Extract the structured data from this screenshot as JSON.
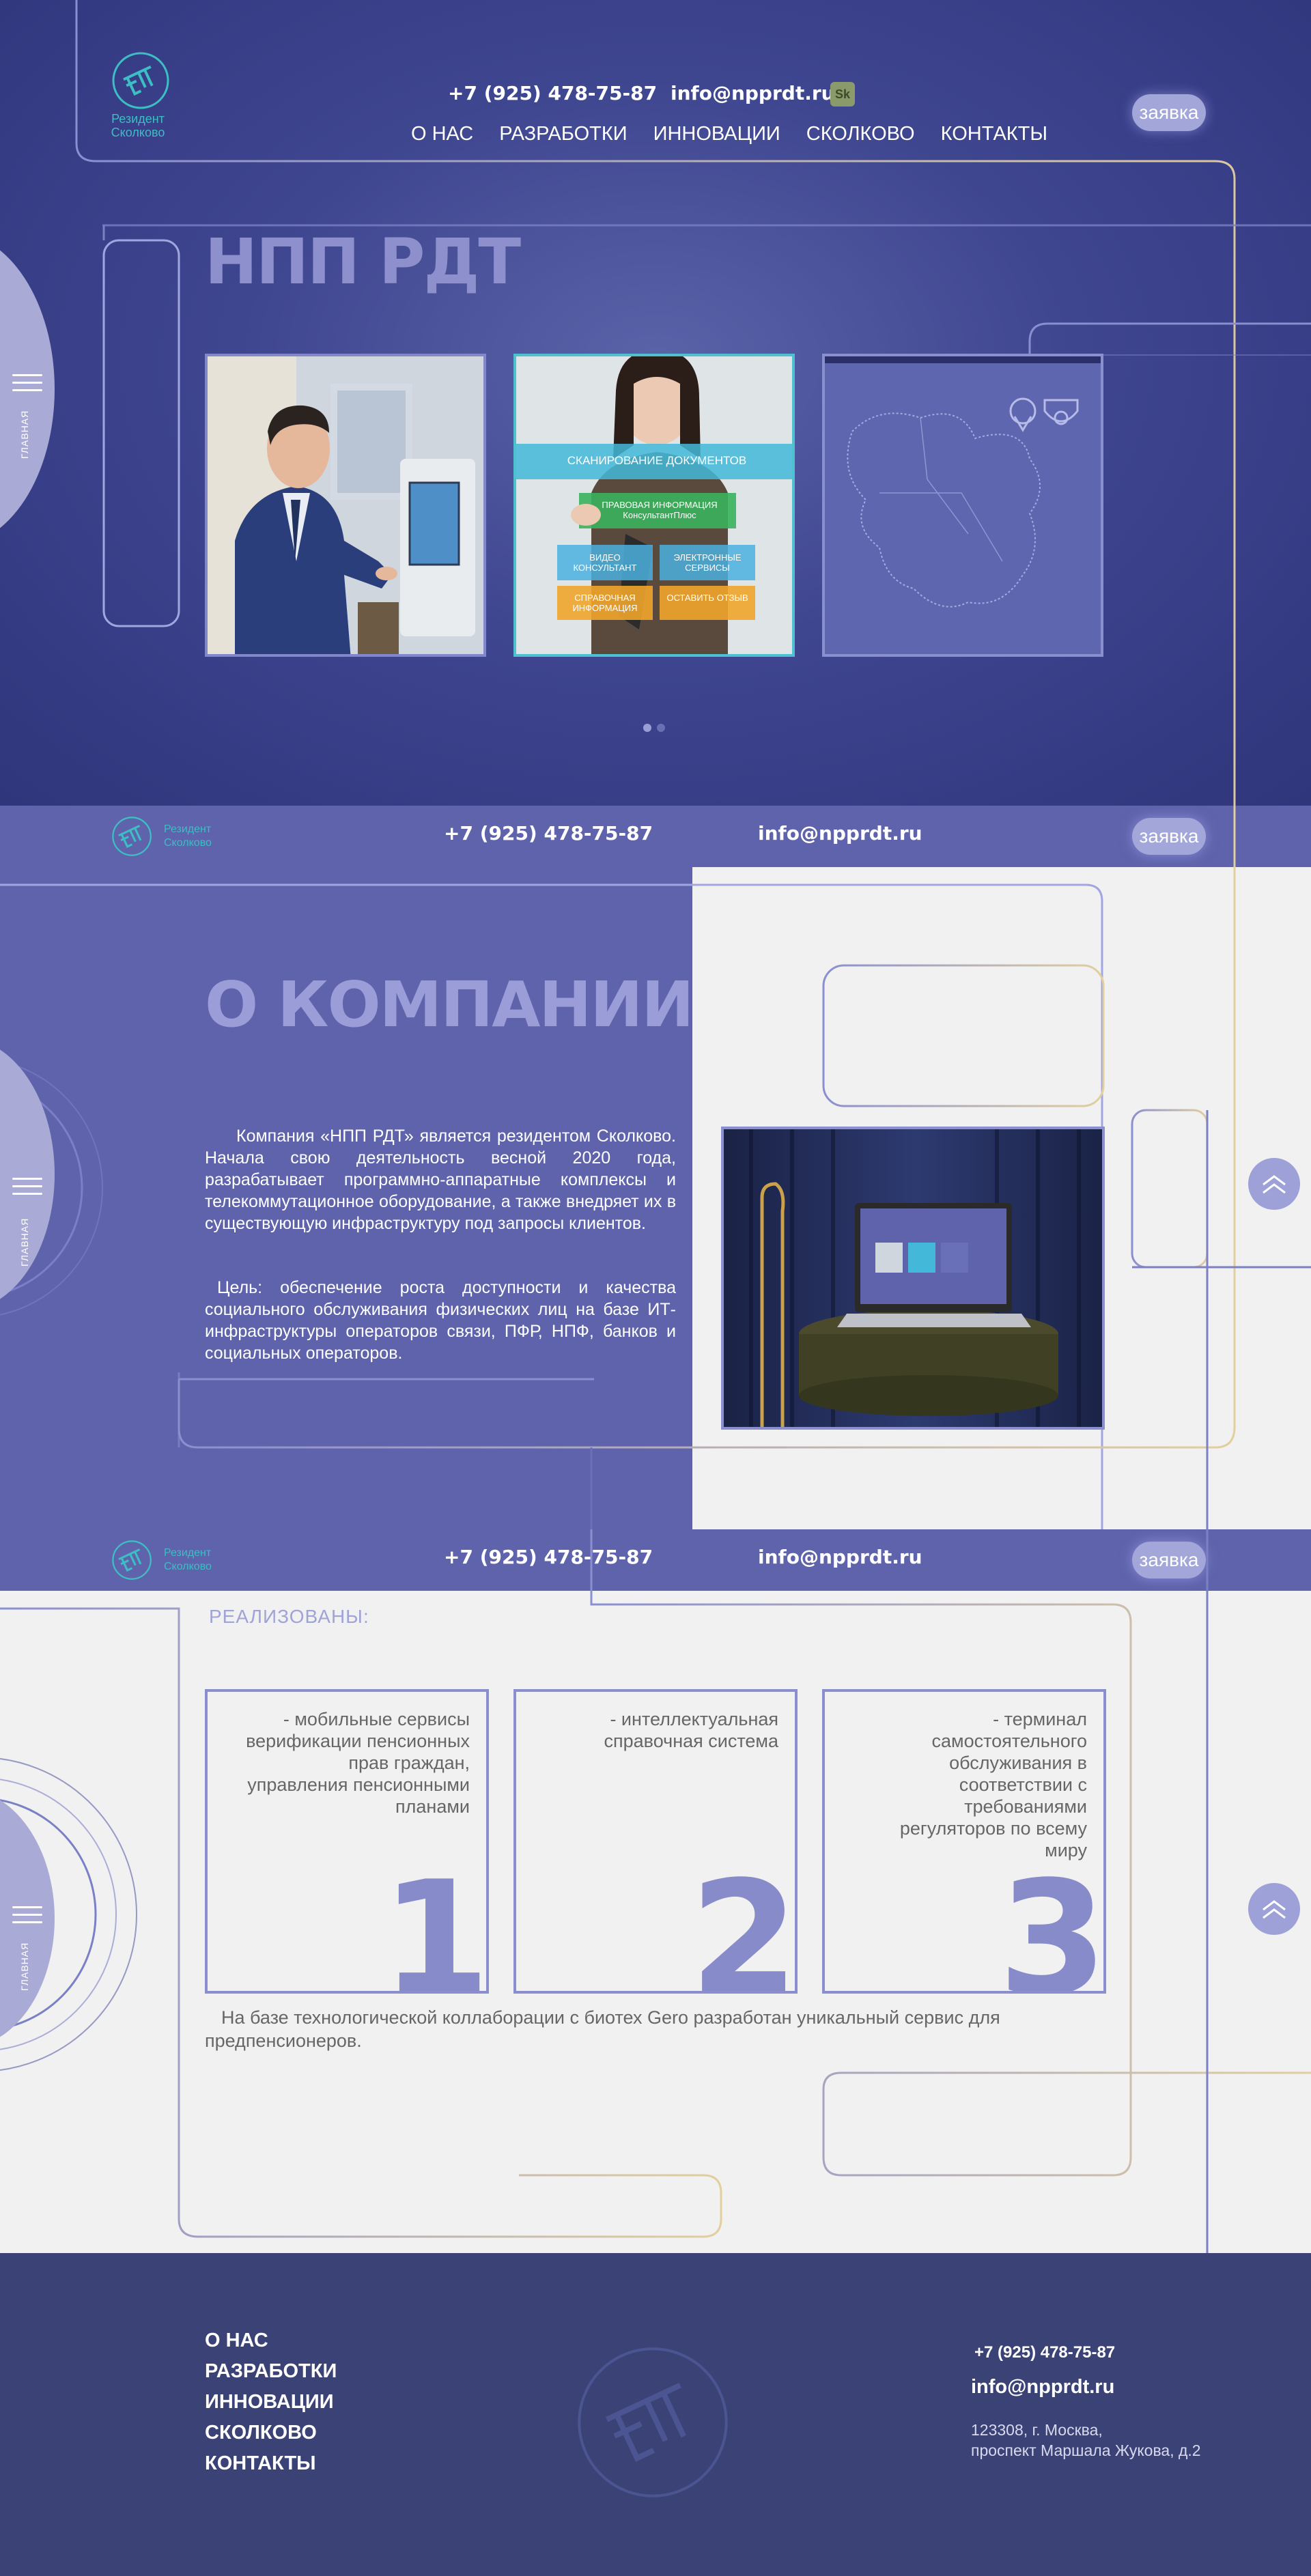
{
  "header": {
    "logo_text_line1": "Резидент",
    "logo_text_line2": "Сколково",
    "phone": "+7 (925) 478-75-87",
    "email": "info@npprdt.ru",
    "sk_badge": "Sk",
    "nav": [
      "О НАС",
      "РАЗРАБОТКИ",
      "ИННОВАЦИИ",
      "СКОЛКОВО",
      "КОНТАКТЫ"
    ],
    "request_button": "заявка"
  },
  "side_menu": {
    "label": "ГЛАВНАЯ",
    "icon": "hamburger-icon"
  },
  "hero": {
    "title": "НПП РДТ",
    "cards": [
      {
        "name": "terminal-photo"
      },
      {
        "name": "kiosk-menu-photo",
        "menu": [
          "СКАНИРОВАНИЕ ДОКУМЕНТОВ",
          "ПРАВОВАЯ ИНФОРМАЦИЯ КонсультантПлюс",
          "ВИДЕО КОНСУЛЬТАНТ",
          "ЭЛЕКТРОННЫЕ СЕРВИСЫ",
          "СПРАВОЧНАЯ ИНФОРМАЦИЯ",
          "ОСТАВИТЬ ОТЗЫВ"
        ]
      },
      {
        "name": "city-map"
      }
    ],
    "slider_dots": 2
  },
  "about": {
    "title": "О КОМПАНИИ",
    "paragraph1": "Компания «НПП РДТ» является резидентом Сколково. Начала свою деятельность весной 2020 года, разрабатывает программно-аппаратные комплексы и телекоммутационное оборудование, а также внедряет их в существующую инфраструктуру под запросы клиентов.",
    "paragraph2": "Цель: обеспечение роста доступности и качества социального обслуживания физических лиц на базе ИТ-инфраструктуры операторов связи, ПФР, НПФ, банков и социальных операторов."
  },
  "realized": {
    "heading": "РЕАЛИЗОВАНЫ:",
    "items": [
      {
        "text": "- мобильные сервисы верификации пенсионных прав граждан, управления пенсионными планами",
        "number": "1"
      },
      {
        "text": "- интеллектуальная справочная система",
        "number": "2"
      },
      {
        "text": "- терминал самостоятельного обслуживания в соответствии с требованиями регуляторов по всему миру",
        "number": "3"
      }
    ],
    "note": "На базе технологической коллаборации с биотех Gero разработан уникальный сервис для предпенсионеров."
  },
  "footer": {
    "nav": [
      "О НАС",
      "РАЗРАБОТКИ",
      "ИННОВАЦИИ",
      "СКОЛКОВО",
      "КОНТАКТЫ"
    ],
    "phone": "+7 (925) 478-75-87",
    "email": "info@npprdt.ru",
    "address_line1": "123308, г. Москва,",
    "address_line2": "проспект Маршала Жукова, д.2"
  },
  "colors": {
    "primary": "#5e63ab",
    "dark": "#353b83",
    "accent": "#3dbdc4",
    "footer": "#3b4376"
  }
}
